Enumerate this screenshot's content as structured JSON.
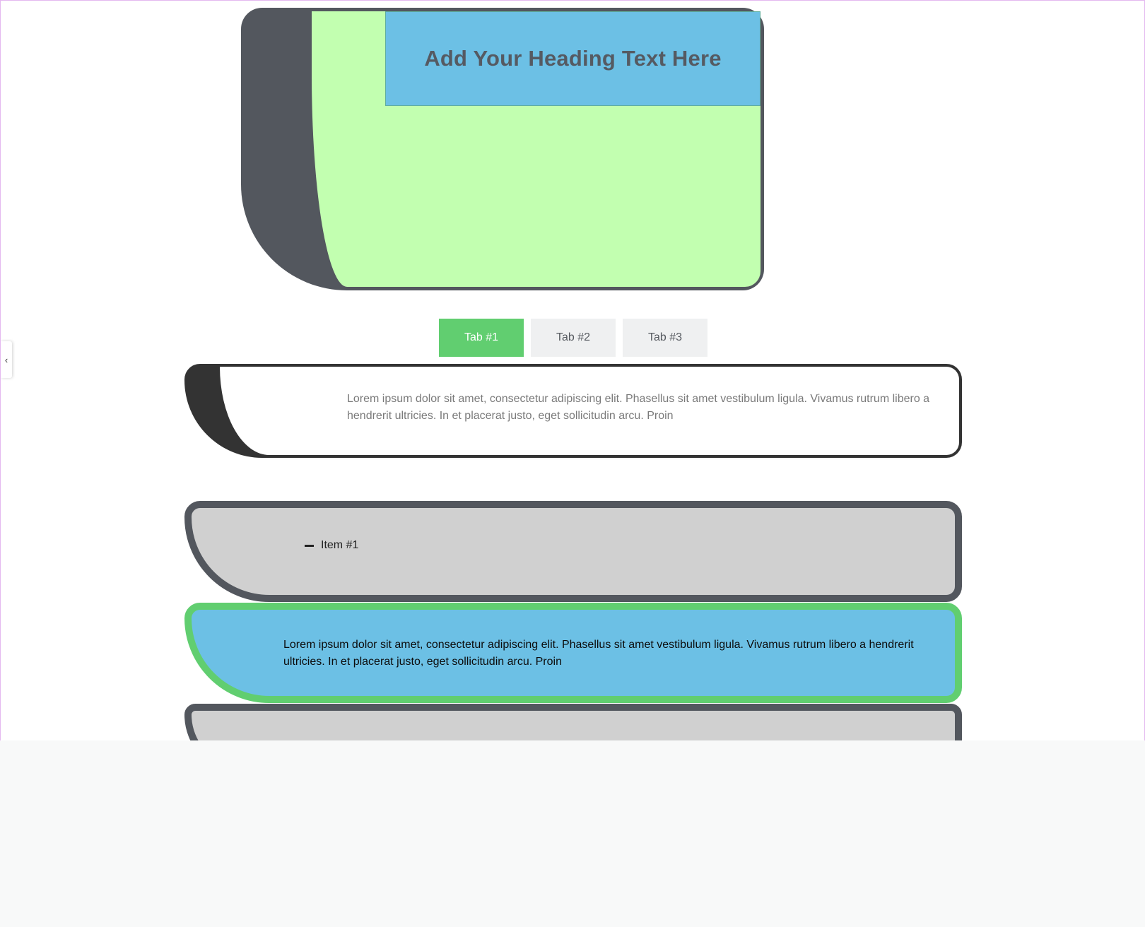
{
  "hero": {
    "heading": "Add Your Heading Text Here"
  },
  "tabs": [
    {
      "label": "Tab #1",
      "active": true
    },
    {
      "label": "Tab #2",
      "active": false
    },
    {
      "label": "Tab #3",
      "active": false
    }
  ],
  "tab_content": "Lorem ipsum dolor sit amet, consectetur adipiscing elit. Phasellus sit amet vestibulum ligula. Vivamus rutrum libero a hendrerit ultricies. In et placerat justo, eget sollicitudin arcu. Proin",
  "accordion": {
    "item1_title": "Item #1",
    "item1_body": "Lorem ipsum dolor sit amet, consectetur adipiscing elit. Phasellus sit amet vestibulum ligula. Vivamus rutrum libero a hendrerit ultricies. In et placerat justo, eget sollicitudin arcu. Proin"
  },
  "colors": {
    "dark_gray": "#53575e",
    "light_green": "#c2ffb0",
    "sky_blue": "#6cc0e5",
    "accent_green": "#61ce70",
    "light_gray": "#d0d0d0"
  },
  "icons": {
    "collapse_handle": "chevron-left-icon",
    "accordion_toggle": "minus-icon"
  },
  "chevron_glyph": "‹"
}
